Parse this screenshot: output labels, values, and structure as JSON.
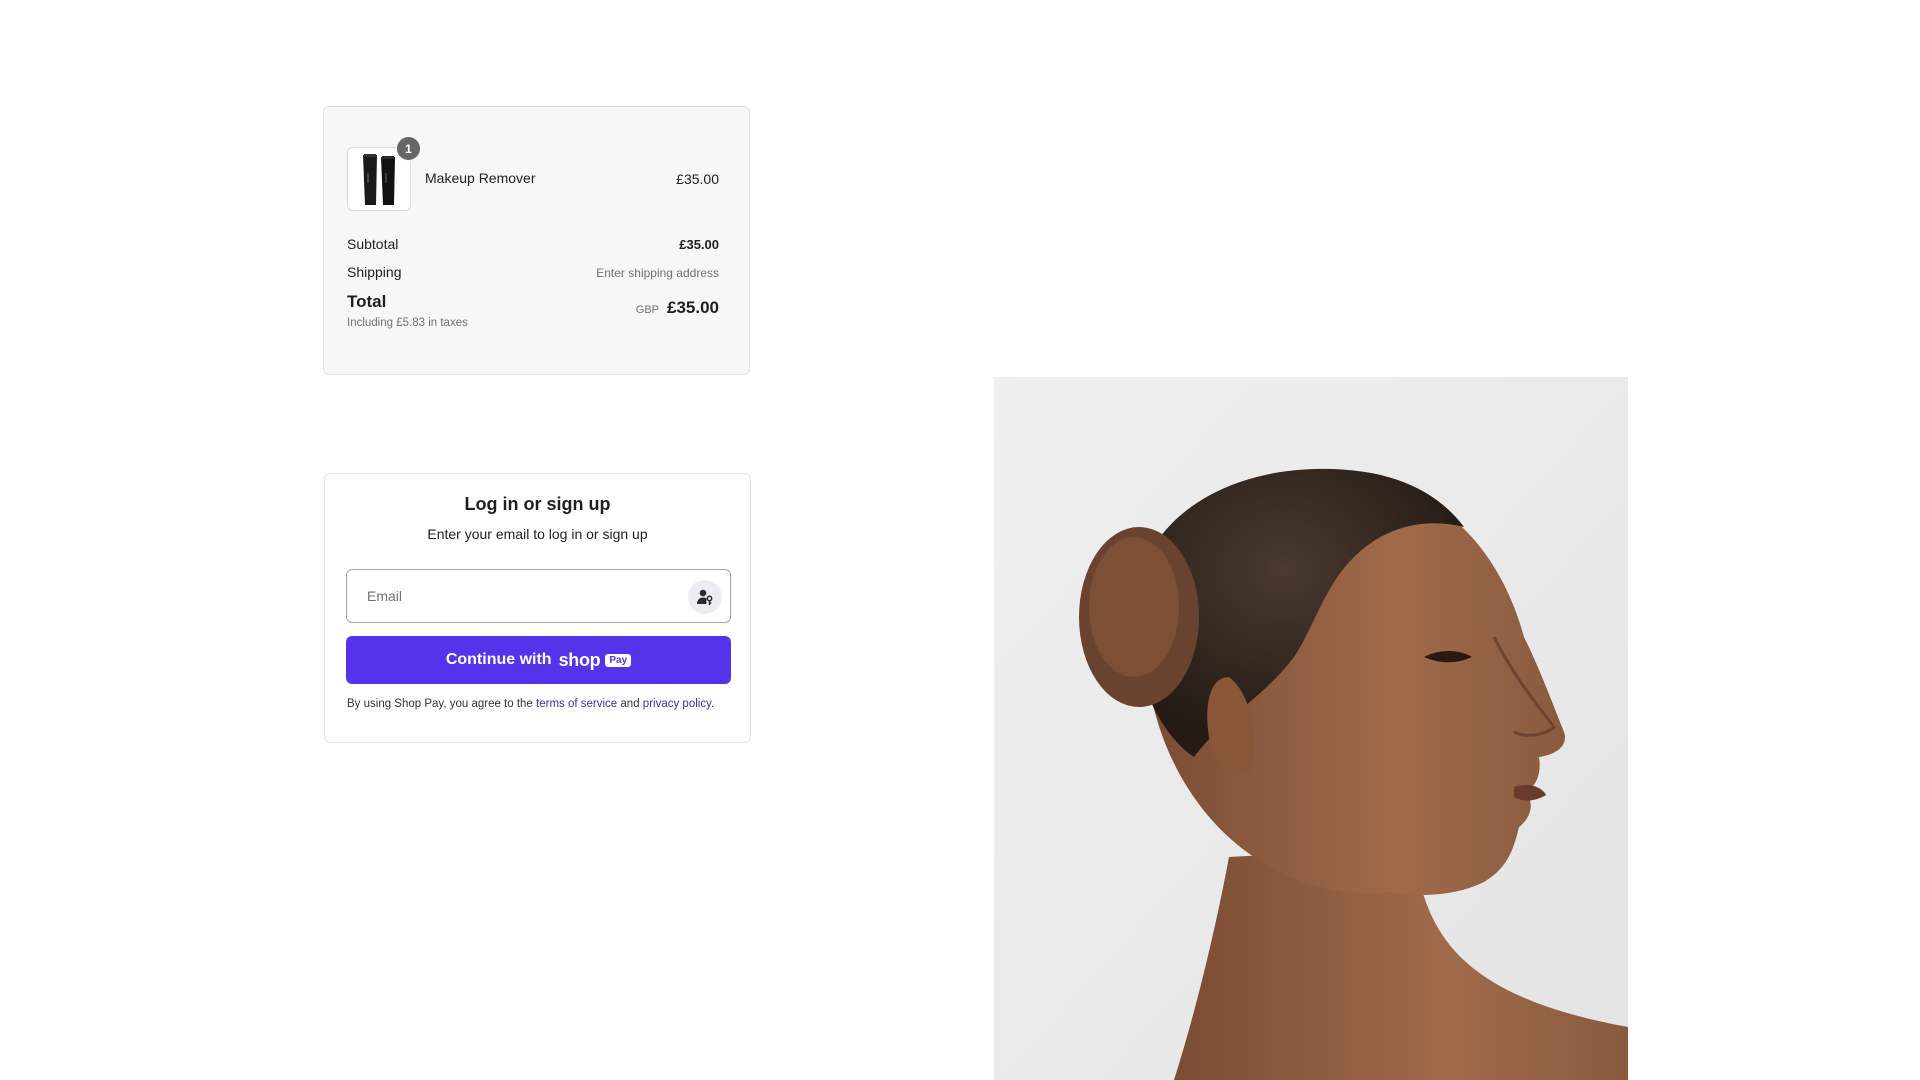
{
  "order_summary": {
    "item": {
      "name": "Makeup Remover",
      "price": "£35.00",
      "quantity": "1"
    },
    "subtotal_label": "Subtotal",
    "subtotal_value": "£35.00",
    "shipping_label": "Shipping",
    "shipping_value": "Enter shipping address",
    "total_label": "Total",
    "tax_note": "Including £5.83 in taxes",
    "currency": "GBP",
    "total_value": "£35.00"
  },
  "login": {
    "title": "Log in or sign up",
    "subtitle": "Enter your email to log in or sign up",
    "email_placeholder": "Email",
    "continue_label": "Continue with",
    "shop_word": "shop",
    "pay_badge": "Pay",
    "legal_prefix": "By using Shop Pay, you agree to the",
    "terms_link": "terms of service",
    "legal_and": "and",
    "privacy_link": "privacy policy",
    "legal_suffix": "."
  },
  "colors": {
    "shop_pay_purple": "#5433eb",
    "link_color": "#3b2fb0",
    "summary_background": "#f7f7f7"
  },
  "icons": {
    "account": "person-with-key-icon"
  }
}
